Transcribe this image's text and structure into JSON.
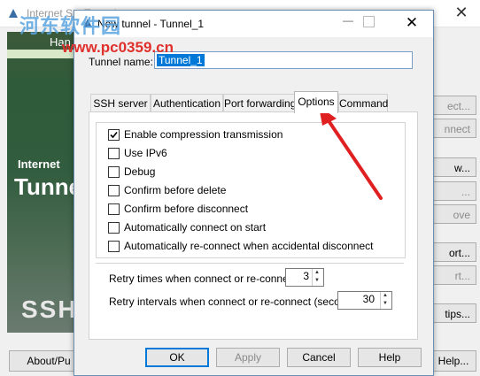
{
  "bg_app": {
    "title": "Internet S... Tunnel...",
    "watermark": "河东软件园",
    "watermark_url": "www.pc0359.cn",
    "banner_brand": "Han",
    "banner_line1": "Internet",
    "banner_line2": "Tunne",
    "banner_line3": "SSH",
    "buttons": [
      "ect...",
      "nnect",
      "w...",
      "...",
      "ove",
      "ort...",
      "rt...",
      "tips..."
    ],
    "about_label": "About/Pu",
    "help_label": "Help..."
  },
  "dialog": {
    "title": "New tunnel - Tunnel_1",
    "tunnel_name_label": "Tunnel name:",
    "tunnel_name_value": "Tunnel_1",
    "tabs": [
      "SSH server",
      "Authentication",
      "Port forwarding",
      "Options",
      "Command"
    ],
    "active_tab": "Options",
    "options": [
      {
        "label": "Enable compression transmission",
        "checked": true
      },
      {
        "label": "Use IPv6",
        "checked": false
      },
      {
        "label": "Debug",
        "checked": false
      },
      {
        "label": "Confirm before delete",
        "checked": false
      },
      {
        "label": "Confirm before disconnect",
        "checked": false
      },
      {
        "label": "Automatically connect on start",
        "checked": false
      },
      {
        "label": "Automatically re-connect when accidental disconnect",
        "checked": false
      }
    ],
    "retry_times_label": "Retry times when connect or re-connect:",
    "retry_times_value": "3",
    "retry_intervals_label": "Retry intervals when connect or re-connect (seconds):",
    "retry_intervals_value": "30",
    "buttons": {
      "ok": "OK",
      "apply": "Apply",
      "cancel": "Cancel",
      "help": "Help"
    }
  },
  "colors": {
    "accent": "#0078d7",
    "arrow": "#e02020"
  }
}
